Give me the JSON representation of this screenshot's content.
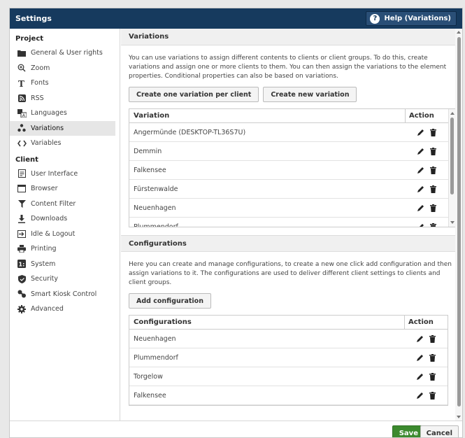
{
  "window": {
    "title": "Settings",
    "help_label": "Help (Variations)"
  },
  "sidebar": {
    "project_label": "Project",
    "project_items": [
      {
        "label": "General & User rights",
        "icon": "folder-icon"
      },
      {
        "label": "Zoom",
        "icon": "zoom-icon"
      },
      {
        "label": "Fonts",
        "icon": "font-icon"
      },
      {
        "label": "RSS",
        "icon": "rss-icon"
      },
      {
        "label": "Languages",
        "icon": "language-icon"
      },
      {
        "label": "Variations",
        "icon": "variations-icon",
        "active": true
      },
      {
        "label": "Variables",
        "icon": "code-icon"
      }
    ],
    "client_label": "Client",
    "client_items": [
      {
        "label": "User Interface",
        "icon": "user-interface-icon"
      },
      {
        "label": "Browser",
        "icon": "browser-icon"
      },
      {
        "label": "Content Filter",
        "icon": "filter-icon"
      },
      {
        "label": "Downloads",
        "icon": "download-icon"
      },
      {
        "label": "Idle & Logout",
        "icon": "logout-icon"
      },
      {
        "label": "Printing",
        "icon": "printer-icon"
      },
      {
        "label": "System",
        "icon": "system-icon"
      },
      {
        "label": "Security",
        "icon": "shield-icon"
      },
      {
        "label": "Smart Kiosk Control",
        "icon": "kiosk-control-icon"
      },
      {
        "label": "Advanced",
        "icon": "gear-icon"
      }
    ]
  },
  "variations": {
    "title": "Variations",
    "description": "You can use variations to assign different contents to clients or client groups. To do this, create variations and assign one or more clients to them. You can then assign the variations to the element properties. Conditional properties can also be based on variations.",
    "btn_per_client": "Create one variation per client",
    "btn_new": "Create new variation",
    "col_variation": "Variation",
    "col_action": "Action",
    "rows": [
      "Angermünde (DESKTOP-TL36S7U)",
      "Demmin",
      "Falkensee",
      "Fürstenwalde",
      "Neuenhagen",
      "Plummendorf"
    ]
  },
  "configurations": {
    "title": "Configurations",
    "description": "Here you can create and manage configurations, to create a new one click add configuration and then assign variations to it. The configurations are used to deliver different client settings to clients and client groups.",
    "btn_add": "Add configuration",
    "col_config": "Configurations",
    "col_action": "Action",
    "rows": [
      "Neuenhagen",
      "Plummendorf",
      "Torgelow",
      "Falkensee"
    ]
  },
  "footer": {
    "save": "Save",
    "cancel": "Cancel"
  },
  "colors": {
    "titlebar": "#163a5e",
    "save": "#3c8a2e"
  }
}
